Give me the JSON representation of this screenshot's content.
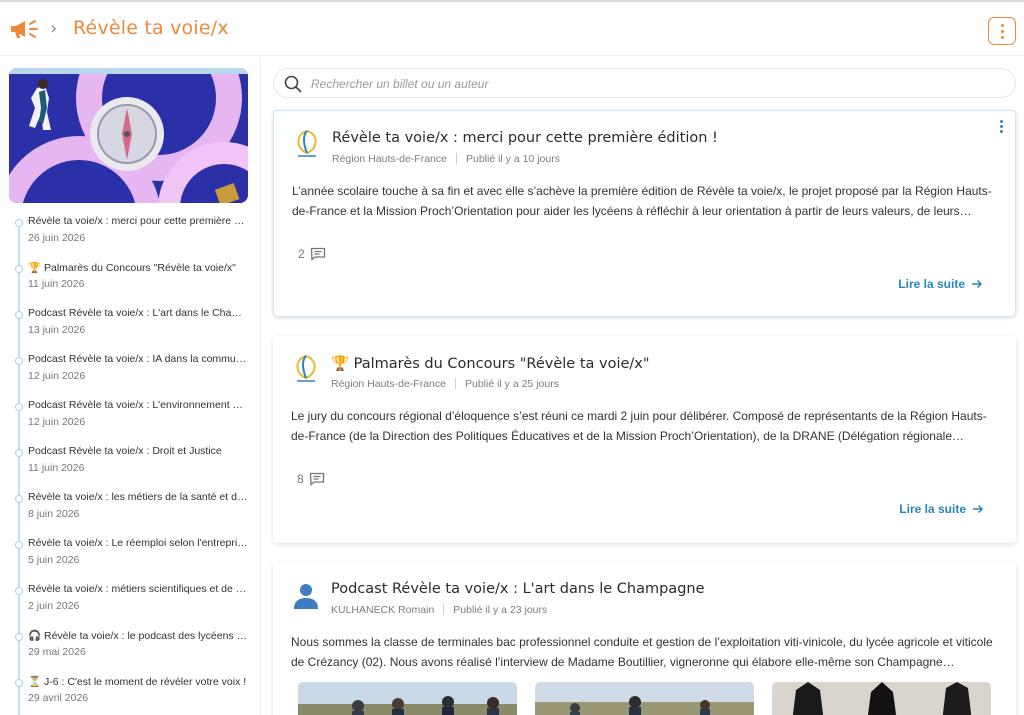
{
  "header": {
    "title": "Révèle ta voie/x",
    "megaphone_icon": "megaphone-icon",
    "menu_icon": "more-vert-icon",
    "accent": "#ec8a3c"
  },
  "sidebar": {
    "items": [
      {
        "title": "Révèle ta voie/x : merci pour cette première édition !",
        "date": "26 juin 2026"
      },
      {
        "title": "🏆 Palmarès du Concours \"Révèle ta voie/x\"",
        "date": "11 juin 2026"
      },
      {
        "title": "Podcast Révèle ta voie/x : L'art dans le Champagne",
        "date": "13 juin 2026"
      },
      {
        "title": "Podcast Révèle ta voie/x : IA dans la communication",
        "date": "12 juin 2026"
      },
      {
        "title": "Podcast Révèle ta voie/x : L'environnement et l'agriculture",
        "date": "12 juin 2026"
      },
      {
        "title": "Podcast Révèle ta voie/x : Droit et Justice",
        "date": "11 juin 2026"
      },
      {
        "title": "Révèle ta voie/x : les métiers de la santé et du social",
        "date": "8 juin 2026"
      },
      {
        "title": "Révèle ta voie/x : Le réemploi selon l'entreprise",
        "date": "5 juin 2026"
      },
      {
        "title": "Révèle ta voie/x : métiers scientifiques et de l'ingénierie",
        "date": "2 juin 2026"
      },
      {
        "title": "🎧 Révèle ta voie/x : le podcast des lycéens de la région",
        "date": "29 mai 2026"
      },
      {
        "title": "⏳ J-6 : C'est le moment de révéler votre voix !",
        "date": "29 avril 2026"
      }
    ]
  },
  "search": {
    "placeholder": "Rechercher un billet ou un auteur",
    "icon": "search-icon"
  },
  "posts": [
    {
      "title": "Révèle ta voie/x : merci pour cette première édition !",
      "author": "Région Hauts-de-France",
      "published": "Publié il y a 10 jours",
      "excerpt": "L’année scolaire touche à sa fin et avec elle s’achève la première édition de Révèle ta voie/x, le projet proposé par la Région Hauts-de-France et la Mission Proch’Orientation pour aider les lycéens à réfléchir à leur orientation à partir de leurs valeurs, de leurs…",
      "comments": "2",
      "read_more": "Lire la suite"
    },
    {
      "title": "🏆 Palmarès du Concours \"Révèle ta voie/x\"",
      "author": "Région Hauts-de-France",
      "published": "Publié il y a 25 jours",
      "excerpt": "Le jury du concours régional d’éloquence s’est réuni ce mardi 2 juin pour délibérer. Composé de représentants de la Région Hauts-de-France (de la Direction des Politiques Éducatives et de la Mission Proch’Orientation), de la DRANE (Délégation régionale…",
      "comments": "8",
      "read_more": "Lire la suite"
    },
    {
      "title": "Podcast Révèle ta voie/x : L'art dans le Champagne",
      "author": "KULHANECK Romain",
      "published": "Publié il y a 23 jours",
      "excerpt": "Nous sommes la classe de terminales bac professionnel conduite et gestion de l’exploitation viti-vinicole, du lycée agricole et viticole de Crézancy (02). Nous avons réalisé l’interview de Madame Boutillier, vigneronne qui élabore elle-même son Champagne…"
    }
  ],
  "colors": {
    "link": "#2a84c0",
    "timeline": "#bfe2f4"
  }
}
